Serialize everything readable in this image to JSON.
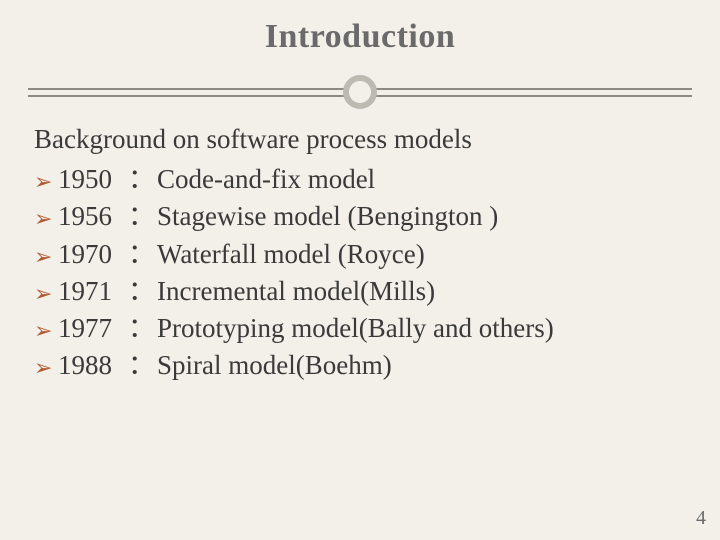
{
  "title": "Introduction",
  "subheading": "Background on software process models",
  "bullet_glyph": "➢",
  "items": [
    {
      "year": "1950",
      "sep": "：",
      "desc": "Code-and-fix model"
    },
    {
      "year": "1956",
      "sep": "：",
      "desc": " Stagewise model (Bengington )"
    },
    {
      "year": "1970",
      "sep": "：",
      "desc": " Waterfall model (Royce)"
    },
    {
      "year": "1971",
      "sep": "：",
      "desc": " Incremental model(Mills)"
    },
    {
      "year": "1977",
      "sep": "：",
      "desc": " Prototyping model(Bally and others)"
    },
    {
      "year": "1988",
      "sep": "：",
      "desc": " Spiral model(Boehm)"
    }
  ],
  "page_number": "4"
}
